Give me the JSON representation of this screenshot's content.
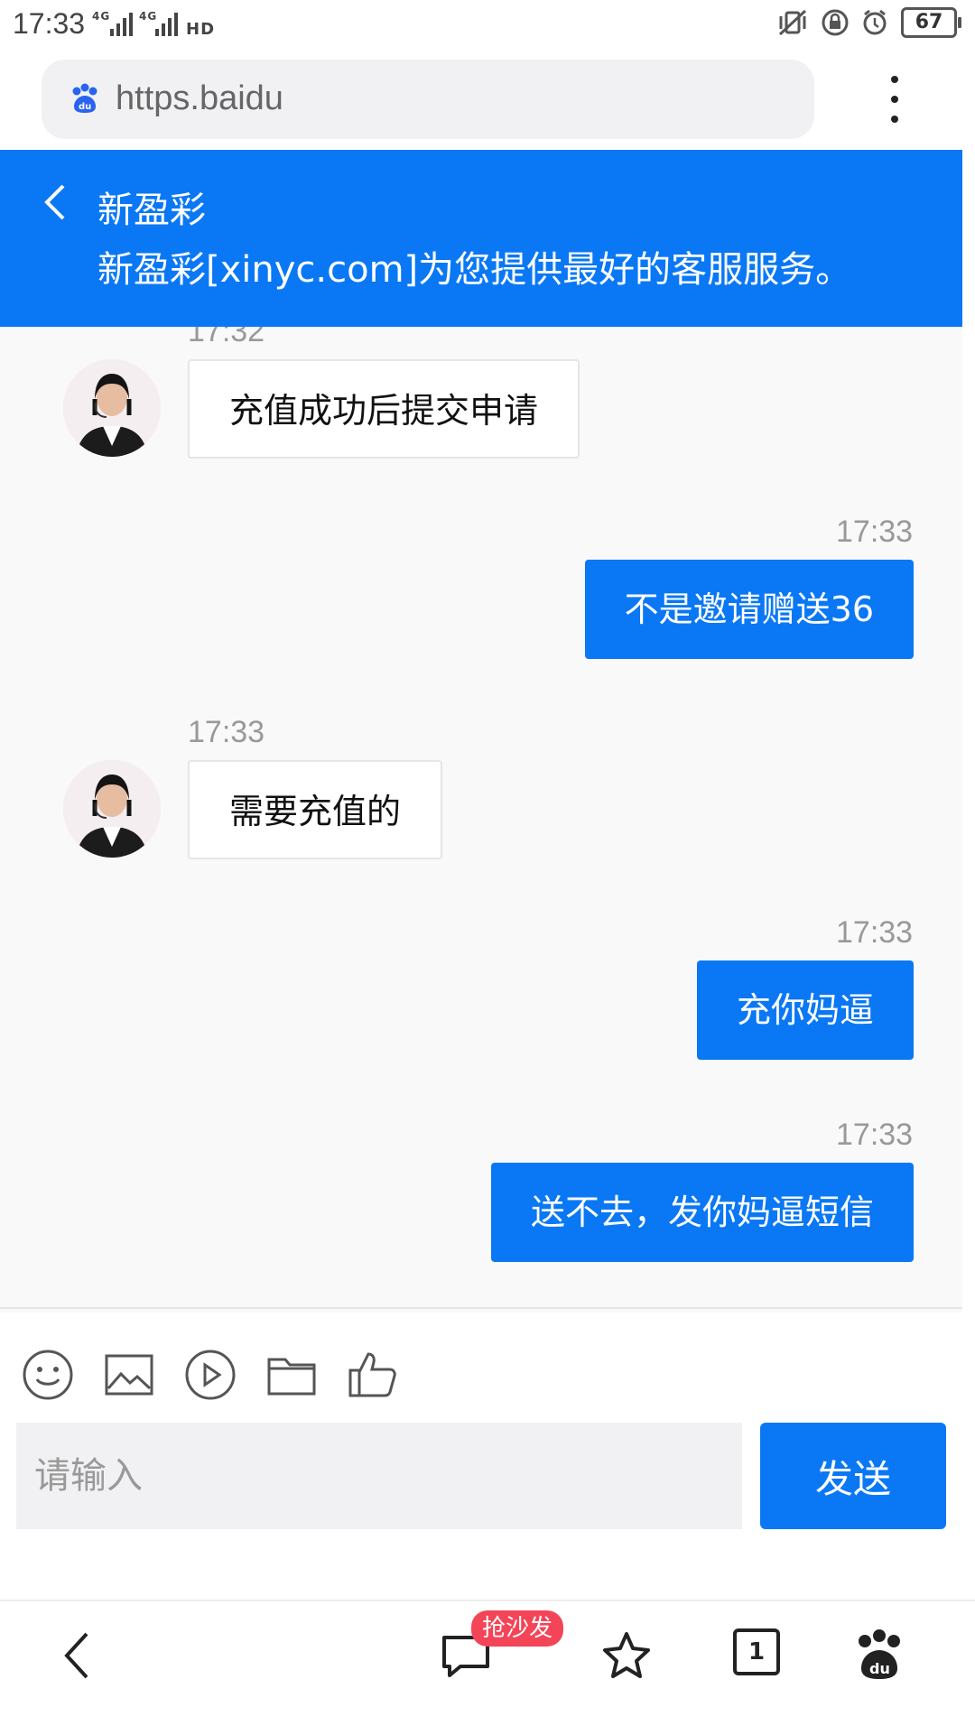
{
  "status_bar": {
    "time": "17:33",
    "network": "⁴⁴⁴⁶G 4G HD",
    "battery": "67"
  },
  "browser": {
    "url": "https.baidu"
  },
  "header": {
    "title": "新盈彩",
    "subtitle": "新盈彩[xinyc.com]为您提供最好的客服服务。"
  },
  "messages": [
    {
      "side": "left",
      "time": "17:32",
      "text": "充值成功后提交申请"
    },
    {
      "side": "right",
      "time": "17:33",
      "text": "不是邀请赠送36"
    },
    {
      "side": "left",
      "time": "17:33",
      "text": "需要充值的"
    },
    {
      "side": "right",
      "time": "17:33",
      "text": "充你妈逼"
    },
    {
      "side": "right",
      "time": "17:33",
      "text": "送不去，发你妈逼短信"
    }
  ],
  "composer": {
    "placeholder": "请输入",
    "send_label": "发送"
  },
  "bottom_nav": {
    "chat_badge": "抢沙发",
    "tabs_count": "1"
  },
  "colors": {
    "accent": "#0a78f5",
    "badge": "#f44458"
  }
}
